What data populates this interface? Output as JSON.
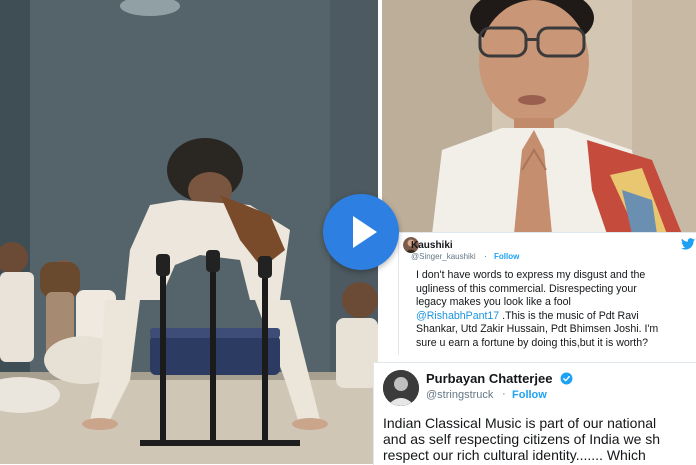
{
  "left_still": {
    "icon": "stage-performance-image"
  },
  "right_photo": {
    "icon": "person-namaste-image"
  },
  "play_button": {
    "icon": "play-icon",
    "color": "#2d7fe2"
  },
  "tweet1": {
    "display_name": "Kaushiki",
    "handle": "@Singer_kaushiki",
    "separator": "·",
    "follow": "Follow",
    "line1": "I don't have words to express my disgust and the",
    "line2": "ugliness of this commercial. Disrespecting your",
    "line3": "legacy makes you look like a fool",
    "mention": "@RishabhPant17",
    "line4_rest": " .This is the music of Pdt Ravi",
    "line5": "Shankar, Utd Zakir Hussain, Pdt Bhimsen Joshi. I'm",
    "line6": "sure u earn a fortune by doing this,but it is worth?",
    "brand_icon": "twitter-bird-icon",
    "accent": "#1da1f2"
  },
  "tweet2": {
    "display_name": "Purbayan Chatterjee",
    "handle": "@stringstruck",
    "separator": "·",
    "follow": "Follow",
    "line1": "Indian Classical Music is part of our national",
    "line2": "and as self respecting citizens of India we sh",
    "line3": "respect our rich cultural identity....... Which",
    "verified_icon": "verified-badge-icon"
  }
}
